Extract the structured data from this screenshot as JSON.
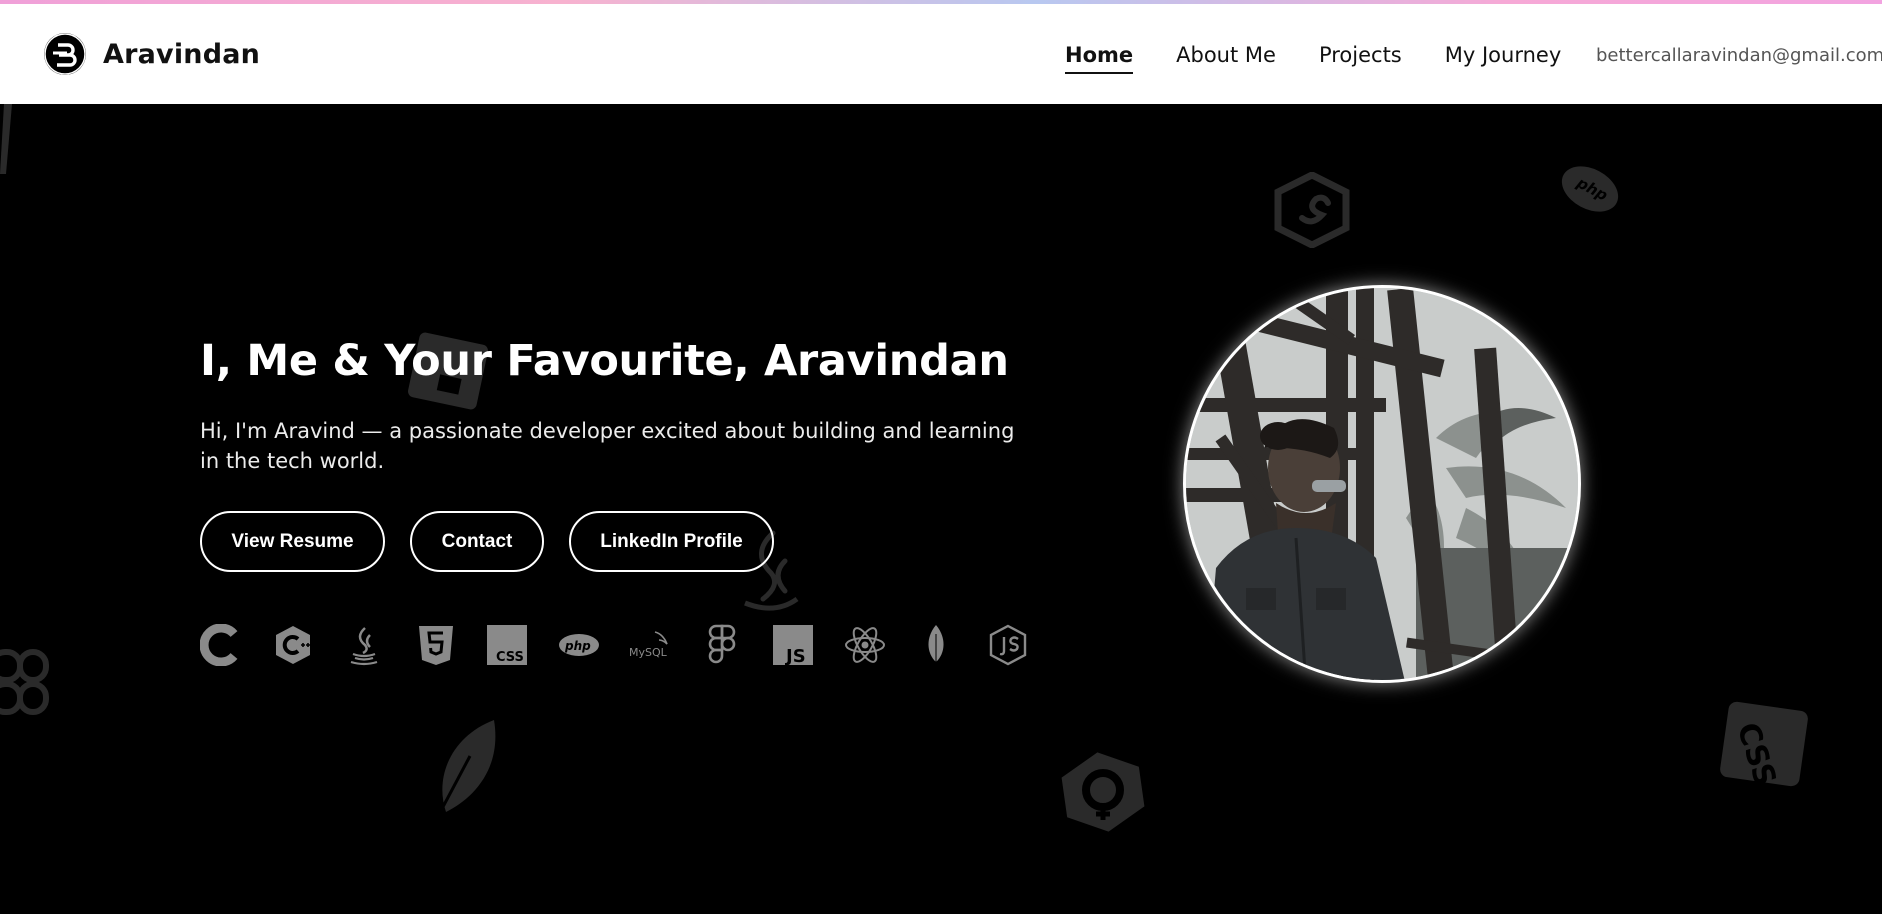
{
  "header": {
    "brand_name": "Aravindan",
    "nav": [
      {
        "label": "Home",
        "active": true
      },
      {
        "label": "About Me",
        "active": false
      },
      {
        "label": "Projects",
        "active": false
      },
      {
        "label": "My Journey",
        "active": false
      }
    ],
    "email": "bettercallaravindan@gmail.com"
  },
  "hero": {
    "title": "I, Me & Your Favourite, Aravindan",
    "subtitle": "Hi, I'm Aravind — a passionate developer excited about building and learning in the tech world.",
    "buttons": {
      "resume": "View Resume",
      "contact": "Contact",
      "linkedin": "LinkedIn Profile"
    }
  },
  "tech_icons": [
    "c-icon",
    "cpp-icon",
    "java-icon",
    "html5-icon",
    "css-icon",
    "php-icon",
    "mysql-icon",
    "figma-icon",
    "javascript-icon",
    "react-icon",
    "mongodb-icon",
    "nodejs-icon"
  ],
  "tech_labels": {
    "css": "CSS",
    "php": "php",
    "mysql": "MySQL",
    "js": "JS"
  },
  "background_labels": {
    "php": "php",
    "css": "CSS"
  },
  "colors": {
    "page_bg": "#000000",
    "header_bg": "#ffffff",
    "icon_gray": "#8a8a8a",
    "bg_icon_gray": "#2a2a2a"
  }
}
